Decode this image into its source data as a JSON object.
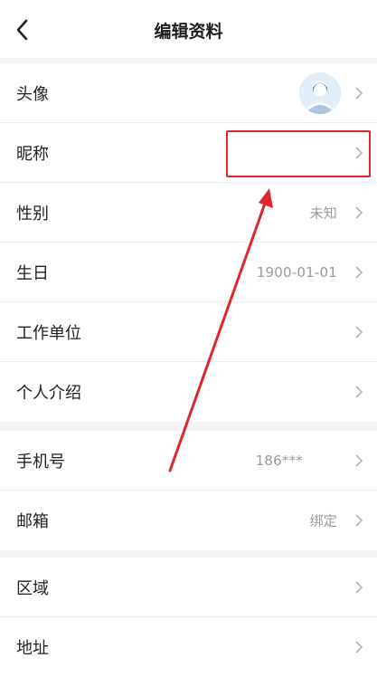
{
  "header": {
    "title": "编辑资料",
    "back_icon": "chevron-left-icon"
  },
  "group1": {
    "items": [
      {
        "label": "头像",
        "value": "",
        "type": "avatar"
      },
      {
        "label": "昵称",
        "value": ""
      },
      {
        "label": "性别",
        "value": "未知"
      },
      {
        "label": "生日",
        "value": "1900-01-01"
      },
      {
        "label": "工作单位",
        "value": ""
      },
      {
        "label": "个人介绍",
        "value": ""
      }
    ]
  },
  "group2": {
    "items": [
      {
        "label": "手机号",
        "value": "186***"
      },
      {
        "label": "邮箱",
        "value": "绑定"
      }
    ]
  },
  "group3": {
    "items": [
      {
        "label": "区域",
        "value": ""
      },
      {
        "label": "地址",
        "value": ""
      }
    ]
  },
  "colors": {
    "annotation": "#e0262a",
    "chevron": "#b5b5b5",
    "value_text": "#9a9a9a"
  }
}
